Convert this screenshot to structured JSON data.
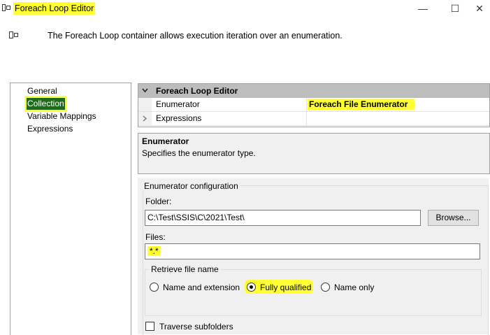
{
  "window": {
    "title": "Foreach Loop Editor",
    "minimize_icon": "—",
    "maximize_icon": "☐",
    "close_icon": "✕"
  },
  "header": {
    "description": "The Foreach Loop container allows execution iteration over an enumeration."
  },
  "nav": {
    "items": [
      {
        "label": "General"
      },
      {
        "label": "Collection"
      },
      {
        "label": "Variable Mappings"
      },
      {
        "label": "Expressions"
      }
    ],
    "selected": "Collection"
  },
  "property_grid": {
    "category": "Foreach Loop Editor",
    "rows": [
      {
        "name": "Enumerator",
        "value": "Foreach File Enumerator"
      },
      {
        "name": "Expressions",
        "value": ""
      }
    ]
  },
  "description_panel": {
    "title": "Enumerator",
    "text": "Specifies the enumerator type."
  },
  "config": {
    "group_title": "Enumerator configuration",
    "folder_label": "Folder:",
    "folder_value": "C:\\Test\\SSIS\\C\\2021\\Test\\",
    "browse_label": "Browse...",
    "files_label": "Files:",
    "files_value": "*.*",
    "retrieve_title": "Retrieve file name",
    "options": [
      {
        "label": "Name and extension",
        "checked": false
      },
      {
        "label": "Fully qualified",
        "checked": true
      },
      {
        "label": "Name only",
        "checked": false
      }
    ],
    "traverse_label": "Traverse subfolders",
    "traverse_checked": false
  },
  "colors": {
    "highlight": "#ffff33",
    "nav_selected": "#1e6b1e"
  }
}
